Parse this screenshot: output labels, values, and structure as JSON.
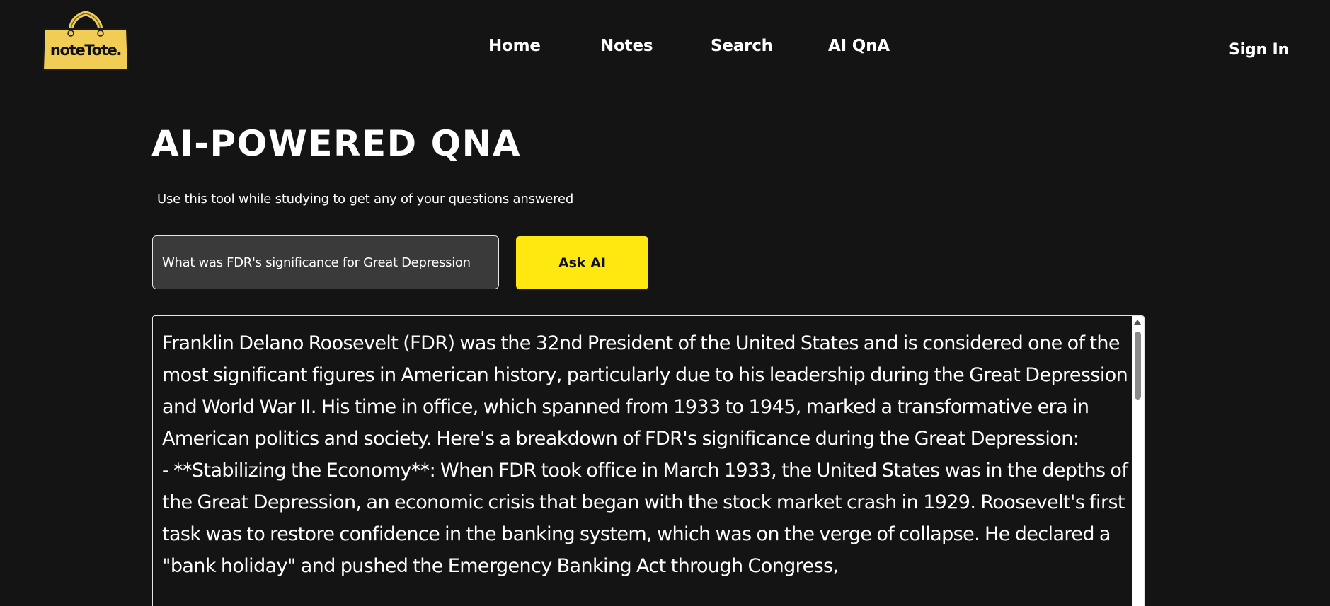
{
  "header": {
    "logo_text": "noteTote.",
    "nav": {
      "home": "Home",
      "notes": "Notes",
      "search": "Search",
      "qna": "AI QnA"
    },
    "sign_in": "Sign In"
  },
  "main": {
    "title": "AI-POWERED QNA",
    "subtitle": "Use this tool while studying to get any of your questions answered",
    "question_value": "What was FDR's significance for Great Depression",
    "ask_button": "Ask AI",
    "answer": "Franklin Delano Roosevelt (FDR) was the 32nd President of the United States and is considered one of the most significant figures in American history, particularly due to his leadership during the Great Depression and World War II. His time in office, which spanned from 1933 to 1945, marked a transformative era in American politics and society. Here's a breakdown of FDR's significance during the Great Depression:\n- **Stabilizing the Economy**: When FDR took office in March 1933, the United States was in the depths of the Great Depression, an economic crisis that began with the stock market crash in 1929. Roosevelt's first task was to restore confidence in the banking system, which was on the verge of collapse. He declared a \"bank holiday\" and pushed the Emergency Banking Act through Congress,"
  },
  "colors": {
    "background": "#141414",
    "accent": "#ffe80f",
    "input_background": "#3a3a3a",
    "text": "#ffffff"
  },
  "icons": {
    "logo": "tote-bag-icon",
    "scroll_up": "scroll-up-arrow-icon"
  }
}
